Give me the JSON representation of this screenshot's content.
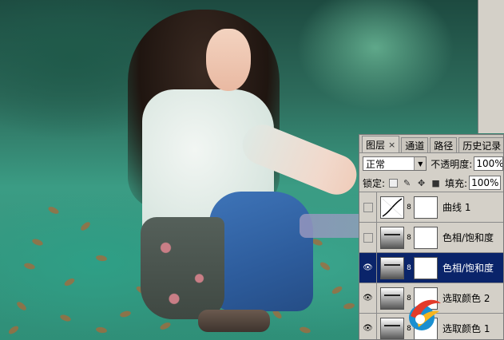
{
  "panel": {
    "tabs": [
      {
        "label": "图层",
        "close": "×"
      },
      {
        "label": "通道"
      },
      {
        "label": "路径"
      },
      {
        "label": "历史记录"
      }
    ],
    "blend_mode": "正常",
    "opacity_label": "不透明度:",
    "opacity_value": "100%",
    "lock_label": "锁定:",
    "fill_label": "填充:",
    "fill_value": "100%",
    "layers": [
      {
        "name": "曲线 1",
        "thumb": "curves-icon",
        "visible": false,
        "selected": false
      },
      {
        "name": "色相/饱和度",
        "thumb": "adjustment-icon",
        "visible": false,
        "selected": false
      },
      {
        "name": "色相/饱和度",
        "thumb": "adjustment-icon",
        "visible": true,
        "selected": true
      },
      {
        "name": "选取颜色 2",
        "thumb": "adjustment-icon",
        "visible": true,
        "selected": false
      },
      {
        "name": "选取颜色 1",
        "thumb": "adjustment-icon",
        "visible": true,
        "selected": false
      }
    ]
  },
  "colors": {
    "selection": "#0a246a",
    "panel_bg": "#d4d0c8"
  }
}
